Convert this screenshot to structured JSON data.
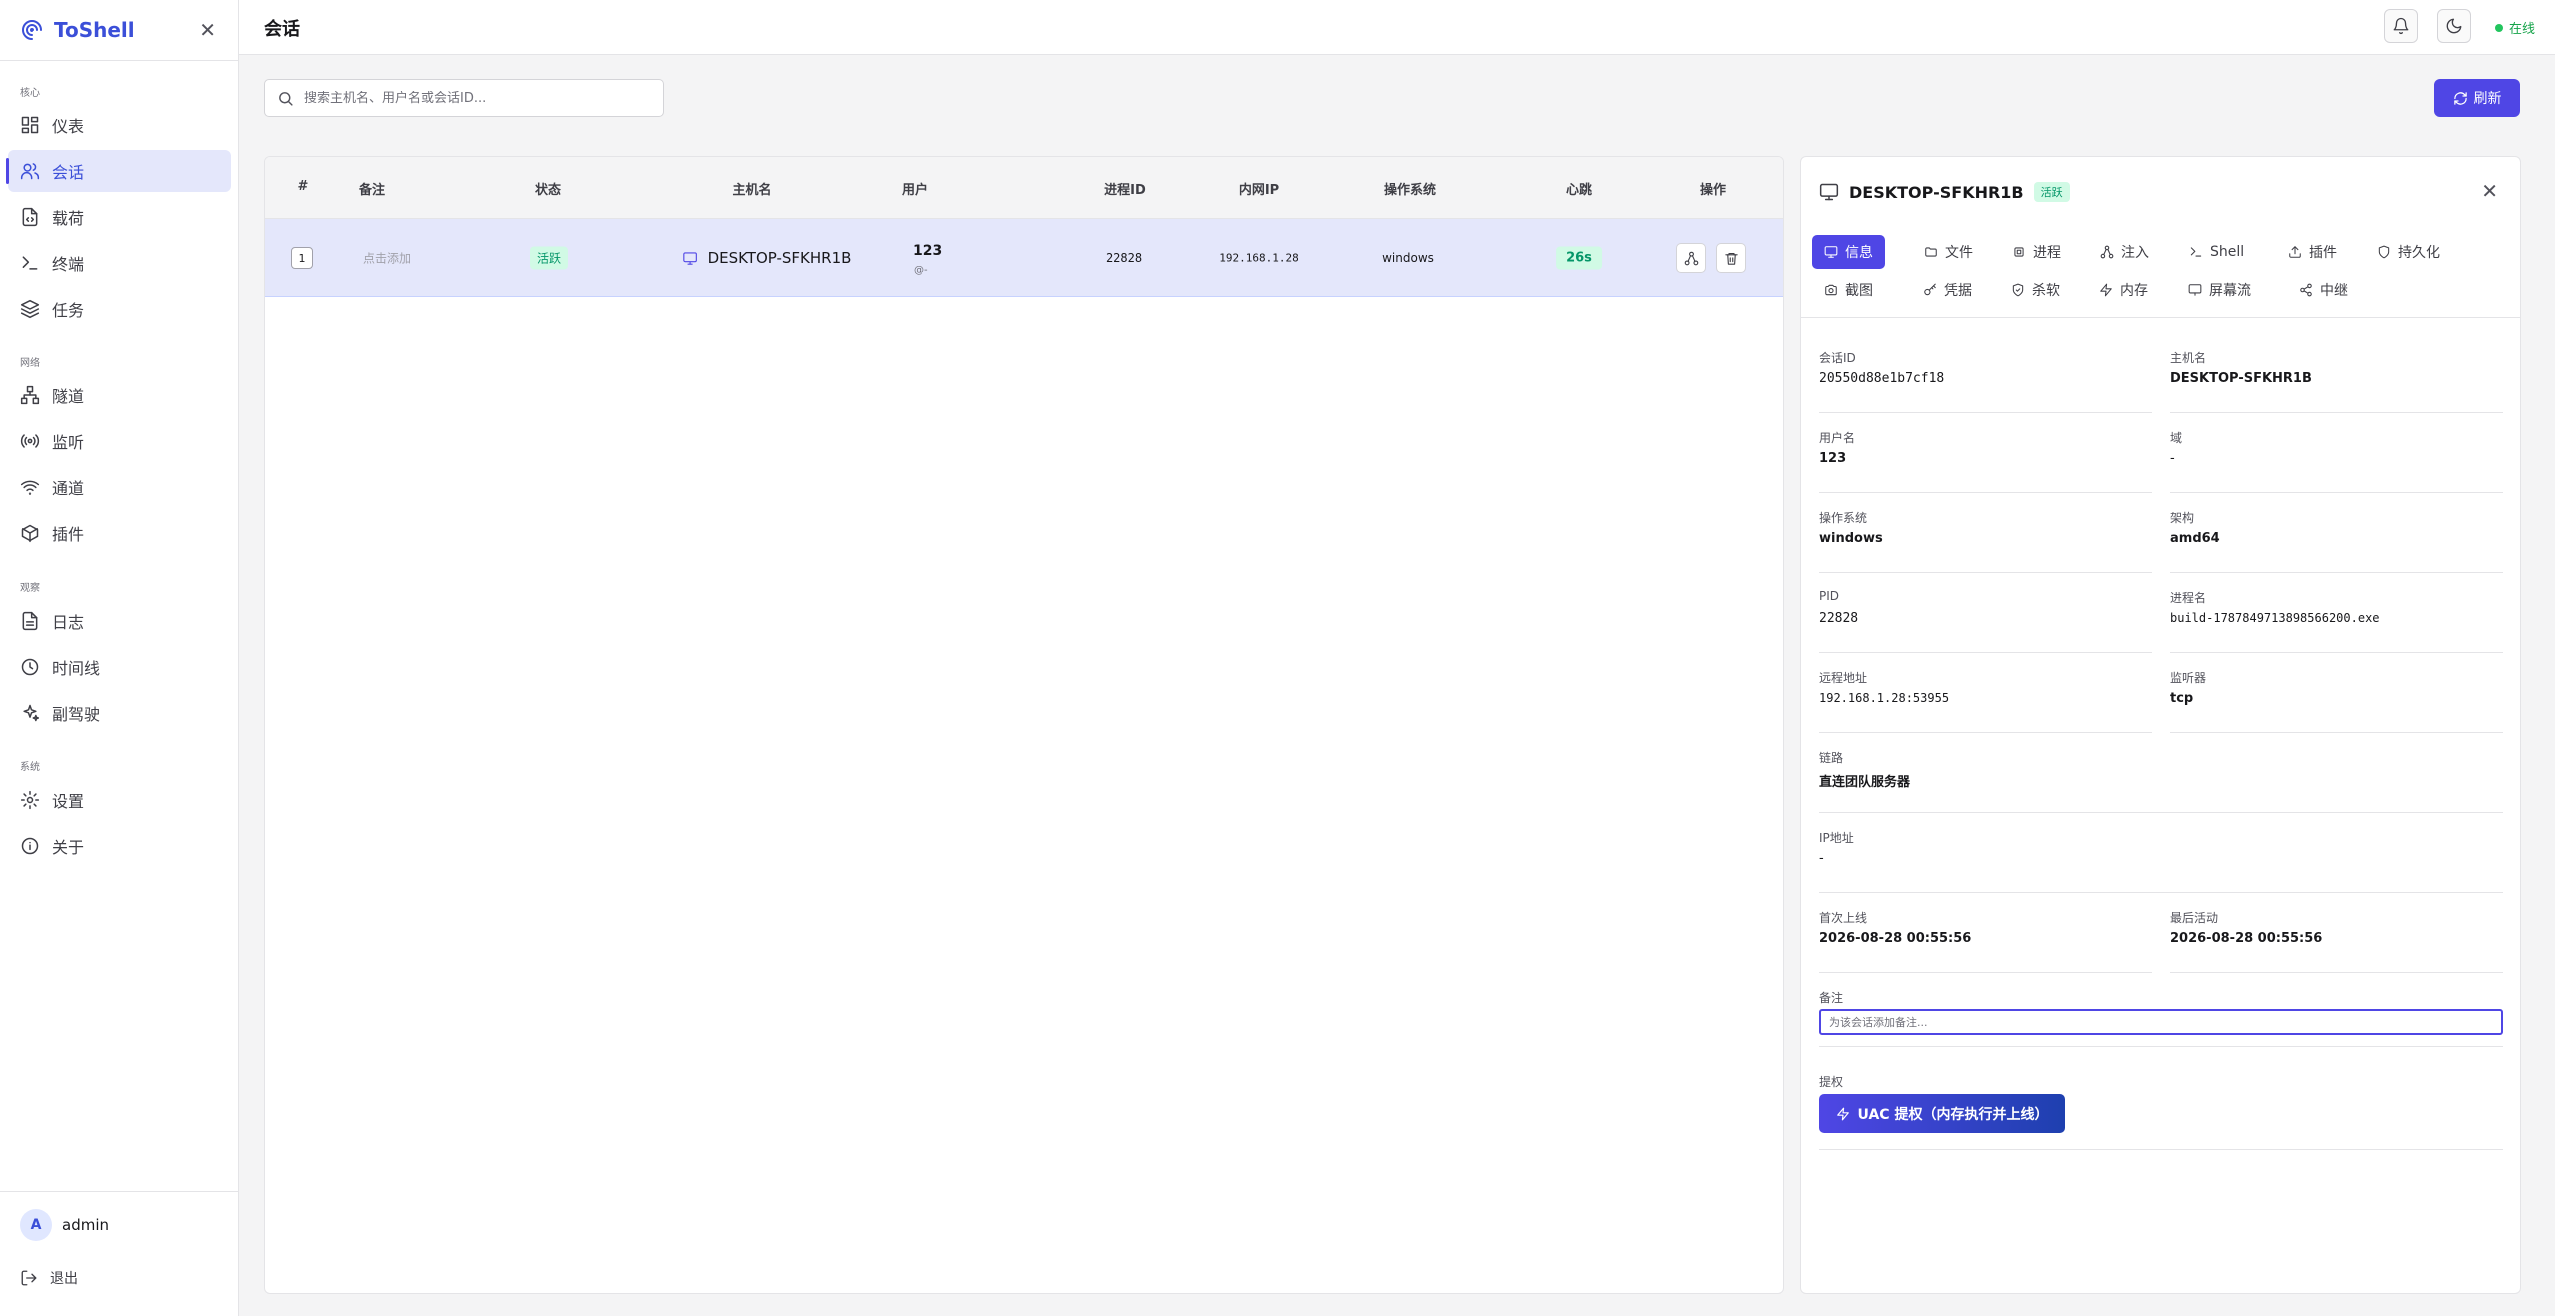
{
  "sidebar": {
    "brand": "ToShell",
    "groups": {
      "core": "核心",
      "network": "网络",
      "observe": "观察",
      "system": "系统"
    },
    "items": {
      "dashboard": "仪表",
      "sessions": "会话",
      "payloads": "载荷",
      "terminal": "终端",
      "tasks": "任务",
      "tunnels": "隧道",
      "listeners": "监听",
      "channels": "通道",
      "plugins": "插件",
      "logs": "日志",
      "timeline": "时间线",
      "copilot": "副驾驶",
      "settings": "设置",
      "about": "关于"
    },
    "user": {
      "avatar": "A",
      "name": "admin"
    },
    "logout": "退出"
  },
  "header": {
    "title": "会话",
    "status": "在线"
  },
  "search": {
    "placeholder": "搜索主机名、用户名或会话ID..."
  },
  "refresh_label": "刷新",
  "table": {
    "columns": [
      "#",
      "备注",
      "状态",
      "主机名",
      "用户",
      "进程ID",
      "内网IP",
      "操作系统",
      "心跳",
      "操作"
    ],
    "rows": [
      {
        "index": "1",
        "note": "点击添加",
        "status": "活跃",
        "hostname": "DESKTOP-SFKHR1B",
        "user": "123",
        "user_sub": "@-",
        "pid": "22828",
        "ip": "192.168.1.28",
        "os": "windows",
        "heartbeat": "26s"
      }
    ]
  },
  "detail": {
    "title": "DESKTOP-SFKHR1B",
    "status": "活跃",
    "tabs": [
      "信息",
      "文件",
      "进程",
      "注入",
      "Shell",
      "插件",
      "持久化",
      "截图",
      "凭据",
      "杀软",
      "内存",
      "屏幕流",
      "中继"
    ],
    "fields": {
      "session_id": {
        "label": "会话ID",
        "value": "20550d88e1b7cf18"
      },
      "hostname": {
        "label": "主机名",
        "value": "DESKTOP-SFKHR1B"
      },
      "username": {
        "label": "用户名",
        "value": "123"
      },
      "domain": {
        "label": "域",
        "value": "-"
      },
      "os": {
        "label": "操作系统",
        "value": "windows"
      },
      "arch": {
        "label": "架构",
        "value": "amd64"
      },
      "pid": {
        "label": "PID",
        "value": "22828"
      },
      "process_name": {
        "label": "进程名",
        "value": "build-1787849713898566200.exe"
      },
      "remote_addr": {
        "label": "远程地址",
        "value": "192.168.1.28:53955"
      },
      "listener": {
        "label": "监听器",
        "value": "tcp"
      },
      "route": {
        "label": "链路",
        "value": "直连团队服务器"
      },
      "ip_addr": {
        "label": "IP地址",
        "value": "-"
      },
      "first_seen": {
        "label": "首次上线",
        "value": "2026-08-28 00:55:56"
      },
      "last_active": {
        "label": "最后活动",
        "value": "2026-08-28 00:55:56"
      }
    },
    "note": {
      "label": "备注",
      "placeholder": "为该会话添加备注..."
    },
    "privesc": {
      "label": "提权",
      "button": "UAC 提权（内存执行并上线）"
    }
  },
  "colors": {
    "accent": "#4f46e5",
    "active_bg": "#e4e7fb",
    "success": "#059669"
  }
}
